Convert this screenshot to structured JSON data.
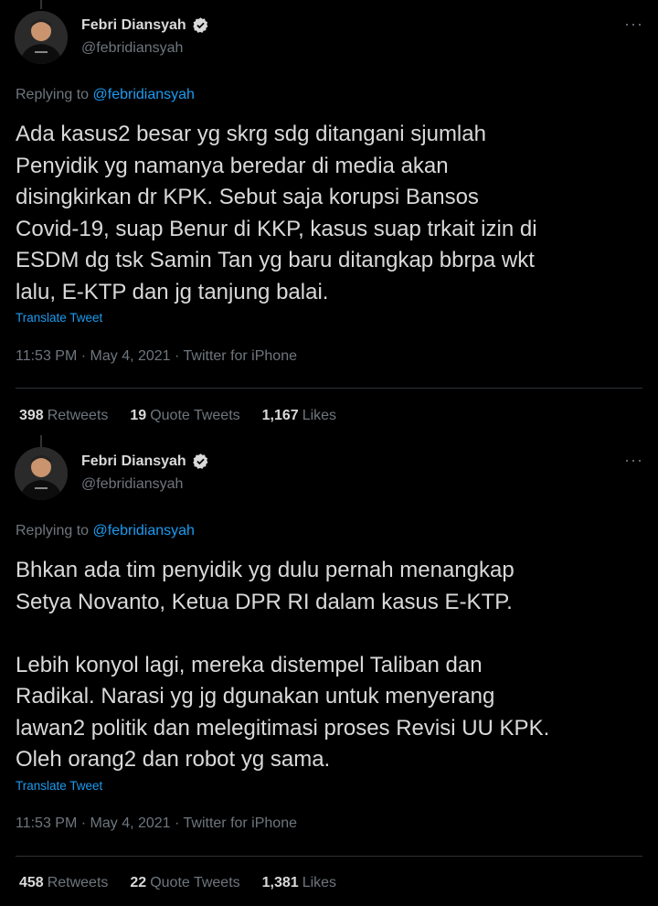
{
  "tweets": [
    {
      "author_name": "Febri Diansyah",
      "author_handle": "@febridiansyah",
      "more_label": "···",
      "replying_prefix": "Replying to",
      "replying_to": "@febridiansyah",
      "text": "Ada kasus2 besar yg skrg sdg ditangani sjumlah\nPenyidik yg namanya beredar di media akan\ndisingkirkan dr KPK. Sebut saja korupsi Bansos\nCovid-19, suap Benur di KKP, kasus suap trkait izin di\nESDM dg tsk Samin Tan yg baru ditangkap bbrpa wkt\nlalu, E-KTP dan jg tanjung balai.",
      "translate_label": "Translate Tweet",
      "timestamp": "11:53 PM · May 4, 2021 · Twitter for iPhone",
      "retweets_count": "398",
      "retweets_label": "Retweets",
      "quotes_count": "19",
      "quotes_label": "Quote Tweets",
      "likes_count": "1,167",
      "likes_label": "Likes"
    },
    {
      "author_name": "Febri Diansyah",
      "author_handle": "@febridiansyah",
      "more_label": "···",
      "replying_prefix": "Replying to",
      "replying_to": "@febridiansyah",
      "text": "Bhkan ada tim penyidik yg dulu pernah menangkap\nSetya Novanto, Ketua DPR RI dalam kasus E-KTP.\n\nLebih konyol lagi, mereka distempel Taliban dan\nRadikal. Narasi yg jg dgunakan untuk menyerang\nlawan2 politik dan melegitimasi proses Revisi UU KPK.\nOleh orang2 dan robot yg sama.",
      "translate_label": "Translate Tweet",
      "timestamp": "11:53 PM · May 4, 2021 · Twitter for iPhone",
      "retweets_count": "458",
      "retweets_label": "Retweets",
      "quotes_count": "22",
      "quotes_label": "Quote Tweets",
      "likes_count": "1,381",
      "likes_label": "Likes"
    }
  ],
  "colors": {
    "background": "#000000",
    "accent": "#1d9bf0",
    "muted": "#6e767d",
    "text": "#d9d9d9"
  }
}
